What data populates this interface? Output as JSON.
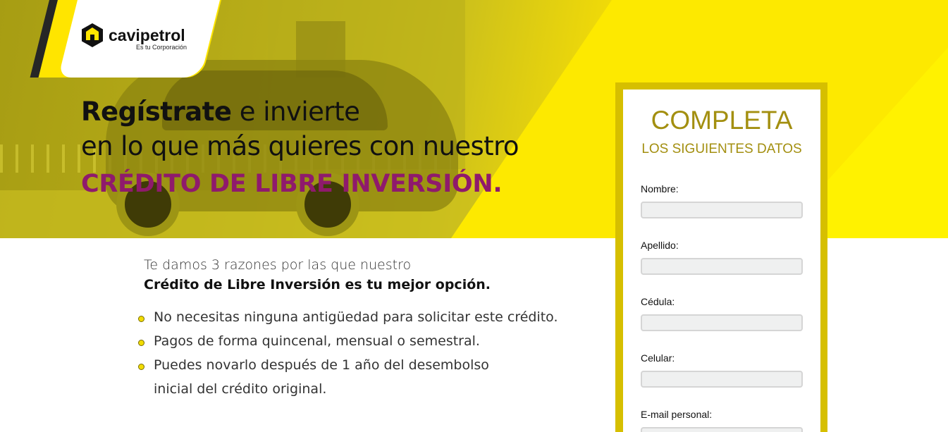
{
  "brand": {
    "name": "cavipetrol",
    "tagline": "Es tu Corporación"
  },
  "headline": {
    "line1_bold": "Regístrate",
    "line1_rest": " e invierte",
    "line2": "en lo que más quieres con nuestro",
    "line3": "CRÉDITO DE LIBRE INVERSIÓN."
  },
  "reasons": {
    "intro": "Te damos 3 razones por las que nuestro",
    "intro_bold": "Crédito de Libre Inversión es tu mejor opción.",
    "items": [
      "No necesitas ninguna antigüedad para solicitar este crédito.",
      "Pagos de forma quincenal, mensual o semestral.",
      "Puedes novarlo después de 1 año del desembolso"
    ],
    "item3_cont": "inicial del crédito original."
  },
  "form": {
    "title": "COMPLETA",
    "subtitle": "LOS SIGUIENTES DATOS",
    "fields": [
      {
        "label": "Nombre:",
        "value": ""
      },
      {
        "label": "Apellido:",
        "value": ""
      },
      {
        "label": "Cédula:",
        "value": ""
      },
      {
        "label": "Celular:",
        "value": ""
      },
      {
        "label": "E-mail personal:",
        "value": ""
      }
    ]
  },
  "colors": {
    "brand_yellow": "#ffe500",
    "accent_purple": "#8f1a6c",
    "form_gold": "#d6bf00",
    "form_text": "#a38f10"
  },
  "icons": {
    "logo": "house-hexagon-icon",
    "bullet": "yellow-dot-icon"
  }
}
